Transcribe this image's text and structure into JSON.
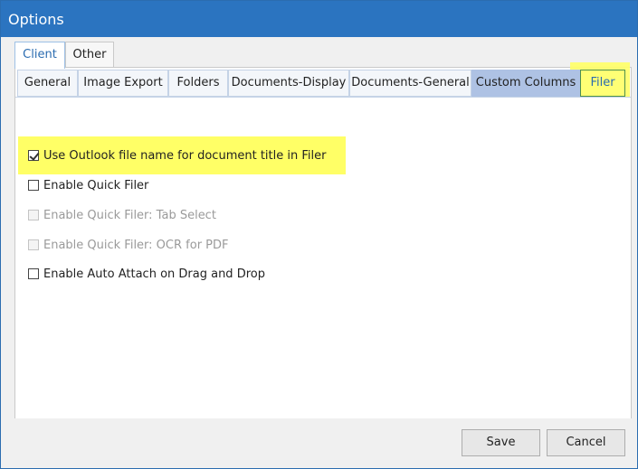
{
  "window": {
    "title": "Options"
  },
  "outer_tabs": [
    {
      "label": "Client",
      "active": true
    },
    {
      "label": "Other",
      "active": false
    }
  ],
  "inner_tabs": [
    {
      "label": "General"
    },
    {
      "label": "Image Export"
    },
    {
      "label": "Folders"
    },
    {
      "label": "Documents-Display"
    },
    {
      "label": "Documents-General"
    },
    {
      "label": "Custom Columns"
    },
    {
      "label": "Filer",
      "active": true
    }
  ],
  "options": [
    {
      "label": "Use Outlook file name for document title in Filer",
      "checked": true,
      "enabled": true
    },
    {
      "label": "Enable Quick Filer",
      "checked": false,
      "enabled": true
    },
    {
      "label": "Enable Quick Filer: Tab Select",
      "checked": false,
      "enabled": false
    },
    {
      "label": "Enable Quick Filer: OCR for PDF",
      "checked": false,
      "enabled": false
    },
    {
      "label": "Enable Auto Attach on Drag and Drop",
      "checked": false,
      "enabled": true
    }
  ],
  "buttons": {
    "save": "Save",
    "cancel": "Cancel"
  },
  "colors": {
    "titlebar": "#2b74c0",
    "highlight": "#ffff66",
    "tab_hover": "#aec2e4"
  }
}
